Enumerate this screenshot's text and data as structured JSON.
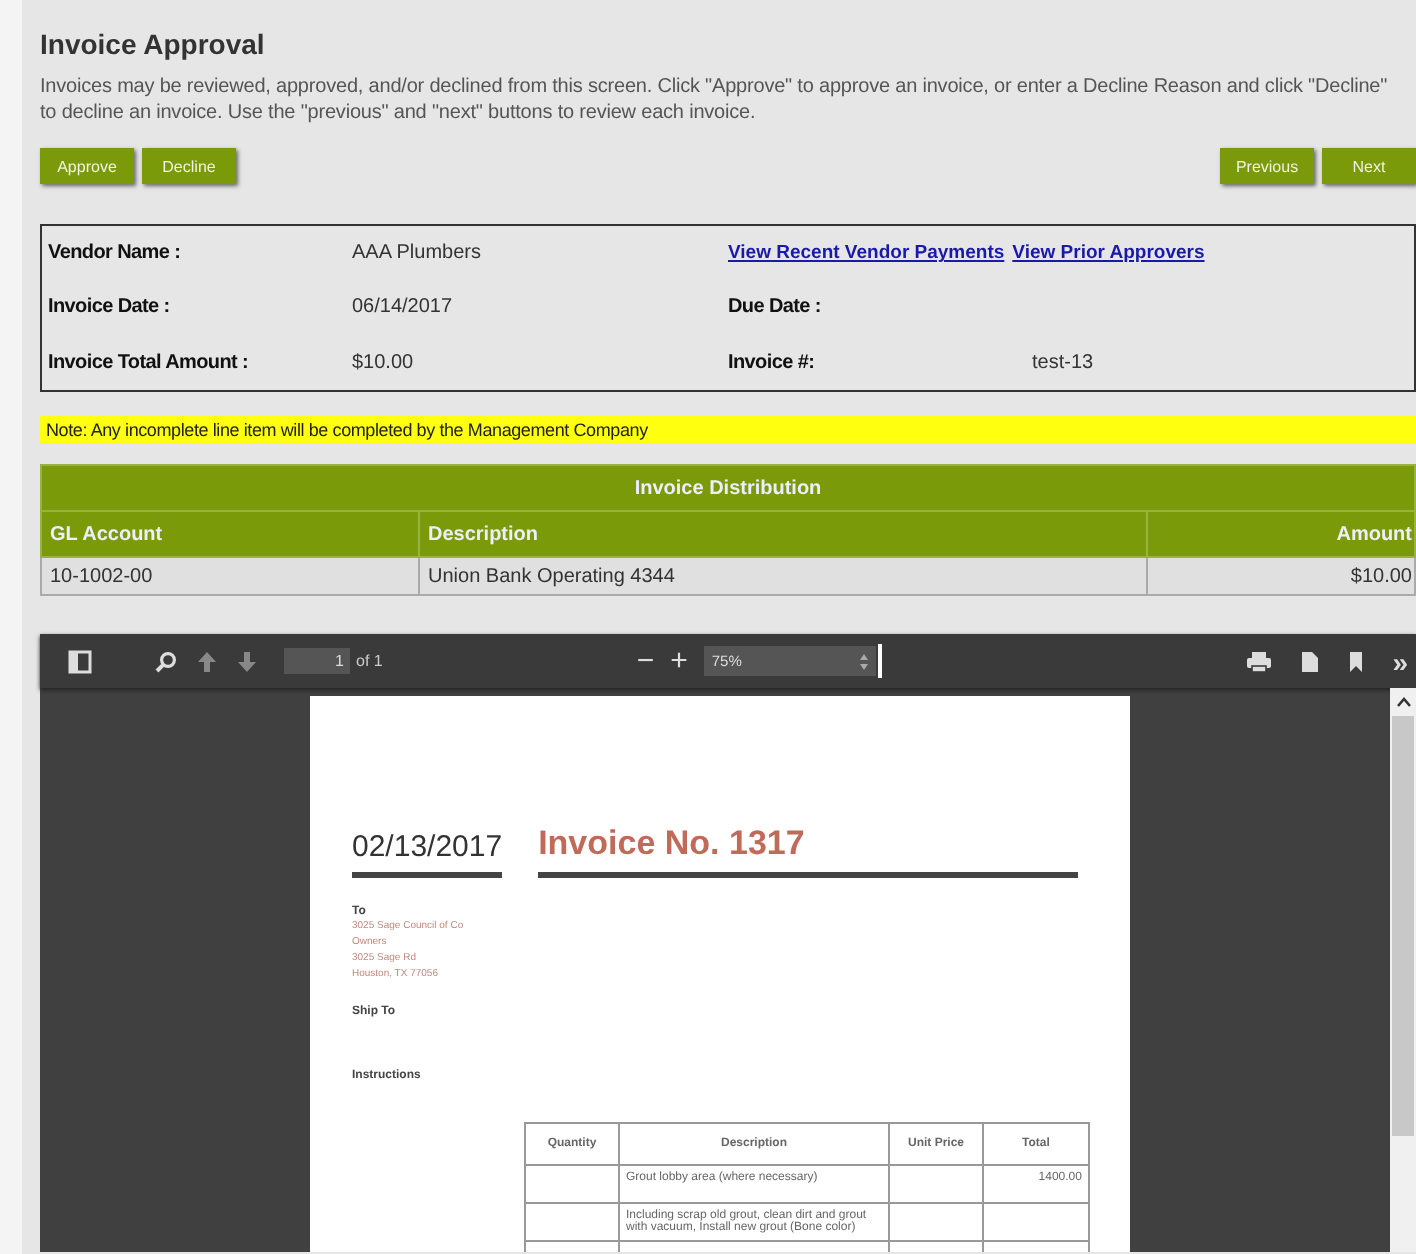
{
  "page": {
    "title": "Invoice Approval",
    "description": "Invoices may be reviewed, approved, and/or declined from this screen. Click \"Approve\" to approve an invoice, or enter a Decline Reason and click \"Decline\" to decline an invoice. Use the \"previous\" and \"next\" buttons to review each invoice."
  },
  "actions_left": [
    "Approve",
    "Decline"
  ],
  "actions_right": [
    "Previous",
    "Next"
  ],
  "details": [
    {
      "label": "Vendor Name :",
      "value": "AAA Plumbers",
      "links": [
        "View Recent Vendor Payments",
        "View Prior Approvers"
      ]
    },
    {
      "label": "Invoice Date :",
      "value": "06/14/2017",
      "label2": "Due Date :"
    },
    {
      "label": "Invoice Total Amount :",
      "value": "$10.00",
      "label2": "Invoice #:",
      "value2": "test-13"
    }
  ],
  "note": "Note: Any incomplete line item will be completed by the Management Company",
  "distribution": {
    "title": "Invoice Distribution",
    "columns": [
      "GL Account",
      "Description",
      "Amount"
    ],
    "rows": [
      [
        "10-1002-00",
        "Union Bank Operating 4344",
        "$10.00"
      ]
    ]
  },
  "viewer": {
    "page_input": "1",
    "page_count": "of 1",
    "zoom_minus": "−",
    "zoom_plus": "+",
    "zoom": "75%",
    "more": "»",
    "document": {
      "date": "02/13/2017",
      "title": "Invoice No. 1317",
      "to_label": "To",
      "address": [
        "3025 Sage Council of Co",
        "Owners",
        "3025 Sage Rd",
        "Houston, TX 77056"
      ],
      "ship_to": "Ship To",
      "instructions": "Instructions",
      "columns": [
        "Quantity",
        "Description",
        "Unit Price",
        "Total"
      ],
      "rows": [
        [
          "",
          "Grout lobby area (where necessary)",
          "",
          "1400.00"
        ],
        [
          "",
          "Including scrap old grout, clean dirt and grout with vacuum, Install new grout (Bone color)",
          "",
          ""
        ],
        [
          "",
          "",
          "",
          ""
        ]
      ]
    }
  }
}
